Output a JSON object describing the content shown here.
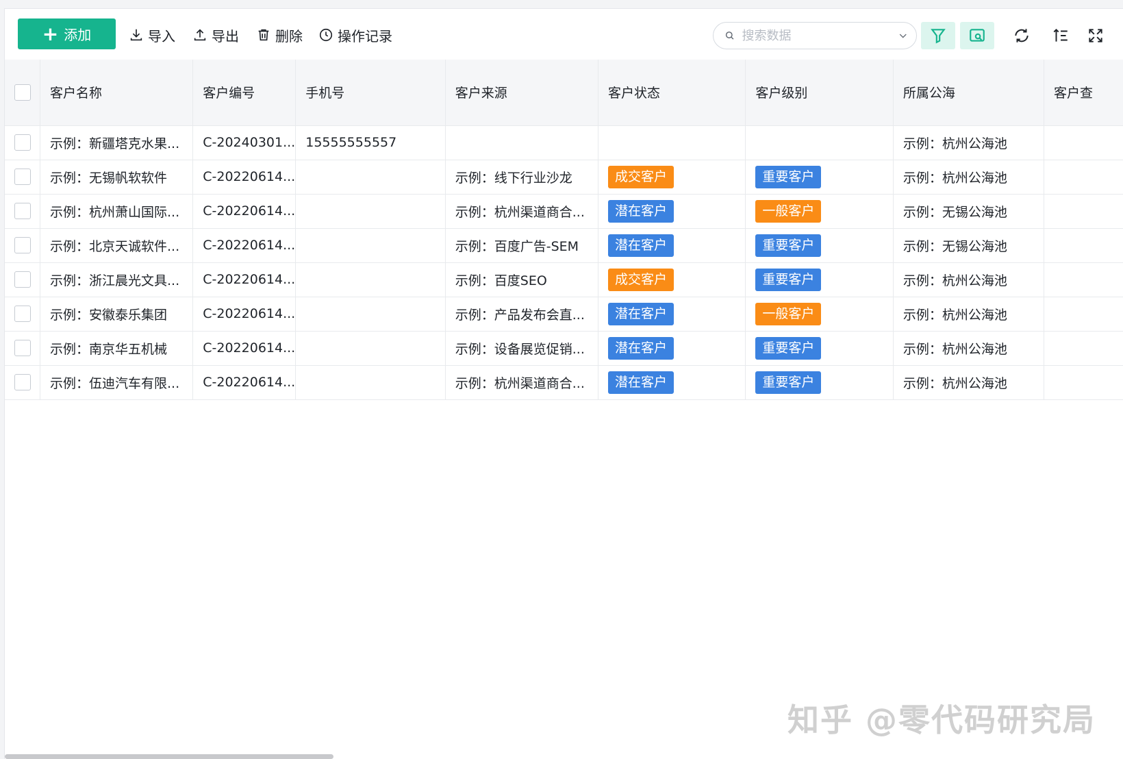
{
  "toolbar": {
    "add_label": "添加",
    "import_label": "导入",
    "export_label": "导出",
    "delete_label": "删除",
    "log_label": "操作记录",
    "search_placeholder": "搜索数据",
    "accent_color": "#16b48e"
  },
  "table": {
    "columns": [
      "客户名称",
      "客户编号",
      "手机号",
      "客户来源",
      "客户状态",
      "客户级别",
      "所属公海",
      "客户查"
    ],
    "rows": [
      {
        "name": "示例：新疆塔克水果...",
        "code": "C-20240301...",
        "phone": "15555555557",
        "source": "",
        "status": "",
        "status_color": "",
        "level": "",
        "level_color": "",
        "pool": "示例：杭州公海池"
      },
      {
        "name": "示例：无锡帆软软件",
        "code": "C-20220614...",
        "phone": "",
        "source": "示例：线下行业沙龙",
        "status": "成交客户",
        "status_color": "#fa8c16",
        "level": "重要客户",
        "level_color": "#3b82e0",
        "pool": "示例：杭州公海池"
      },
      {
        "name": "示例：杭州萧山国际...",
        "code": "C-20220614...",
        "phone": "",
        "source": "示例：杭州渠道商合...",
        "status": "潜在客户",
        "status_color": "#3b82e0",
        "level": "一般客户",
        "level_color": "#fa8c16",
        "pool": "示例：无锡公海池"
      },
      {
        "name": "示例：北京天诚软件...",
        "code": "C-20220614...",
        "phone": "",
        "source": "示例：百度广告-SEM",
        "status": "潜在客户",
        "status_color": "#3b82e0",
        "level": "重要客户",
        "level_color": "#3b82e0",
        "pool": "示例：无锡公海池"
      },
      {
        "name": "示例：浙江晨光文具...",
        "code": "C-20220614...",
        "phone": "",
        "source": "示例：百度SEO",
        "status": "成交客户",
        "status_color": "#fa8c16",
        "level": "重要客户",
        "level_color": "#3b82e0",
        "pool": "示例：杭州公海池"
      },
      {
        "name": "示例：安徽泰乐集团",
        "code": "C-20220614...",
        "phone": "",
        "source": "示例：产品发布会直...",
        "status": "潜在客户",
        "status_color": "#3b82e0",
        "level": "一般客户",
        "level_color": "#fa8c16",
        "pool": "示例：杭州公海池"
      },
      {
        "name": "示例：南京华五机械",
        "code": "C-20220614...",
        "phone": "",
        "source": "示例：设备展览促销...",
        "status": "潜在客户",
        "status_color": "#3b82e0",
        "level": "重要客户",
        "level_color": "#3b82e0",
        "pool": "示例：杭州公海池"
      },
      {
        "name": "示例：伍迪汽车有限...",
        "code": "C-20220614...",
        "phone": "",
        "source": "示例：杭州渠道商合...",
        "status": "潜在客户",
        "status_color": "#3b82e0",
        "level": "重要客户",
        "level_color": "#3b82e0",
        "pool": "示例：杭州公海池"
      }
    ]
  },
  "watermark": "知乎 @零代码研究局"
}
